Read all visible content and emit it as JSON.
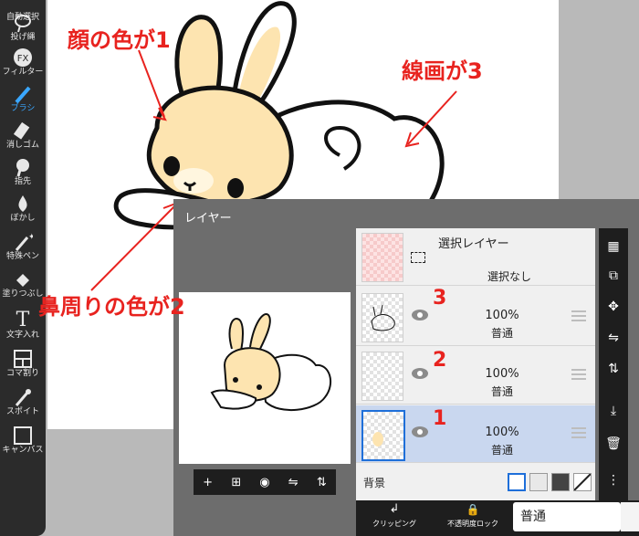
{
  "toolbar": {
    "items": [
      {
        "label": "自動選択",
        "icon": "magic-select-icon"
      },
      {
        "label": "投げ縄",
        "icon": "lasso-icon"
      },
      {
        "label": "フィルター",
        "icon": "fx-icon",
        "icon_text": "FX"
      },
      {
        "label": "ブラシ",
        "icon": "brush-icon",
        "active": true
      },
      {
        "label": "消しゴム",
        "icon": "eraser-icon"
      },
      {
        "label": "指先",
        "icon": "finger-icon"
      },
      {
        "label": "ぼかし",
        "icon": "blur-icon"
      },
      {
        "label": "特殊ペン",
        "icon": "special-pen-icon"
      },
      {
        "label": "塗りつぶし",
        "icon": "fill-icon"
      },
      {
        "label": "文字入れ",
        "icon": "text-icon",
        "icon_text": "T"
      },
      {
        "label": "コマ割り",
        "icon": "frame-divide-icon"
      },
      {
        "label": "スポイト",
        "icon": "eyedropper-icon"
      },
      {
        "label": "キャンバス",
        "icon": "canvas-icon"
      }
    ],
    "accent": "#3aa7ff"
  },
  "annotations": {
    "face": "顔の色が1",
    "lineart": "線画が3",
    "nose": "鼻周りの色が2",
    "color": "#e8231f"
  },
  "panel": {
    "title": "レイヤー",
    "selection_layer": {
      "name": "選択レイヤー",
      "status": "選択なし"
    },
    "layers": [
      {
        "number": "3",
        "opacity": "100%",
        "blend": "普通",
        "selected": false
      },
      {
        "number": "2",
        "opacity": "100%",
        "blend": "普通",
        "selected": false
      },
      {
        "number": "1",
        "opacity": "100%",
        "blend": "普通",
        "selected": true
      }
    ],
    "background_label": "背景",
    "clipping_label": "クリッピング",
    "alpha_lock_label": "不透明度ロック",
    "blend_mode": "普通",
    "preview_tools": [
      "+",
      "⊞",
      "camera-icon",
      "flip-h-icon",
      "flip-v-icon"
    ]
  }
}
